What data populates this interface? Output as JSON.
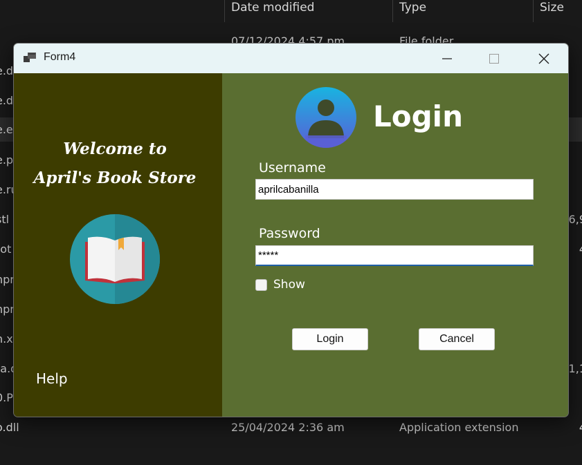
{
  "background": {
    "columns": {
      "date_modified": "Date modified",
      "type": "Type",
      "size": "Size"
    },
    "rows": [
      {
        "name": "",
        "date": "07/12/2024 4:57 pm",
        "type": "File folder",
        "size": ""
      },
      {
        "name": "e.d",
        "date": "",
        "type": "",
        "size": ""
      },
      {
        "name": "e.d",
        "date": "",
        "type": "",
        "size": ""
      },
      {
        "name": "e.e>",
        "date": "",
        "type": "",
        "size": ""
      },
      {
        "name": "e.p",
        "date": "",
        "type": "",
        "size": ""
      },
      {
        "name": "e.ru",
        "date": "",
        "type": "",
        "size": ""
      },
      {
        "name": "stl",
        "date": "",
        "type": "",
        "size": "6,9"
      },
      {
        "name": "tot",
        "date": "",
        "type": "",
        "size": "4"
      },
      {
        "name": "npr",
        "date": "",
        "type": "",
        "size": ""
      },
      {
        "name": "npr",
        "date": "",
        "type": "",
        "size": ""
      },
      {
        "name": "n.x",
        "date": "",
        "type": "",
        "size": ""
      },
      {
        "name": "ta.d",
        "date": "",
        "type": "",
        "size": "1,1"
      },
      {
        "name": "0.Pi",
        "date": "",
        "type": "",
        "size": ""
      },
      {
        "name": "o.dll",
        "date": "25/04/2024 2:36 am",
        "type": "Application extension",
        "size": "4"
      }
    ]
  },
  "window": {
    "title": "Form4",
    "controls": {
      "minimize": "minimize-icon",
      "maximize": "maximize-icon",
      "close": "close-icon"
    }
  },
  "left_panel": {
    "welcome_line1": "Welcome to",
    "welcome_line2": "April's Book Store",
    "logo_icon": "open-book-icon",
    "help": "Help",
    "bg_color": "#3d3c00"
  },
  "right_panel": {
    "title": "Login",
    "avatar_icon": "user-avatar-icon",
    "username_label": "Username",
    "username_value": "aprilcabanilla",
    "password_label": "Password",
    "password_value": "*****",
    "show_label": "Show",
    "show_checked": false,
    "login_button": "Login",
    "cancel_button": "Cancel",
    "bg_color": "#5a6e31"
  }
}
